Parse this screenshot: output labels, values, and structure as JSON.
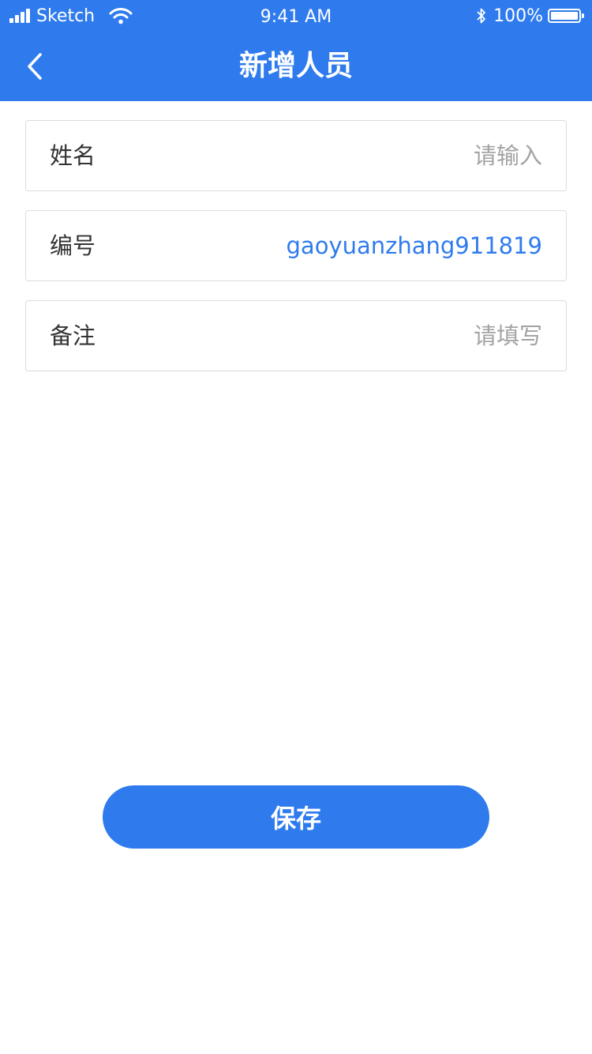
{
  "status_bar": {
    "carrier": "Sketch",
    "time": "9:41 AM",
    "battery_pct": "100%",
    "icons": [
      "signal-icon",
      "wifi-icon",
      "bluetooth-icon",
      "battery-icon"
    ]
  },
  "header": {
    "title": "新增人员",
    "back_icon": "chevron-left-icon"
  },
  "form": {
    "name": {
      "label": "姓名",
      "value": "",
      "placeholder": "请输入"
    },
    "code": {
      "label": "编号",
      "value": "gaoyuanzhang911819",
      "placeholder": ""
    },
    "note": {
      "label": "备注",
      "value": "",
      "placeholder": "请填写"
    }
  },
  "actions": {
    "save_label": "保存"
  },
  "colors": {
    "primary": "#2f7bee",
    "label_text": "#333333",
    "placeholder_text": "#a3a3a3",
    "border": "#dcdcdc",
    "background": "#ffffff"
  }
}
